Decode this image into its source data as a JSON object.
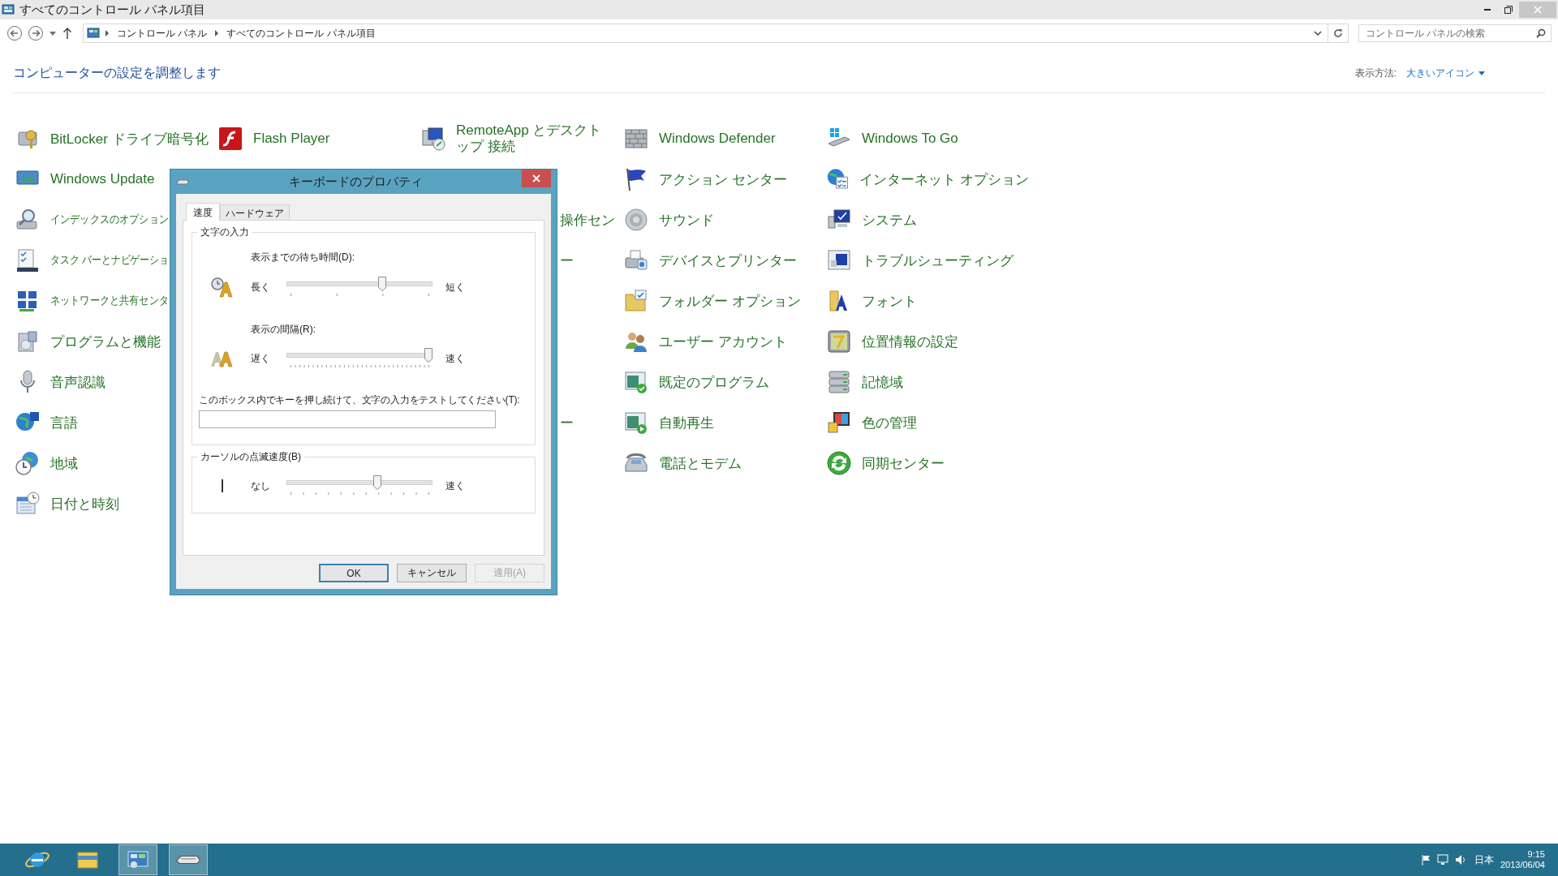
{
  "window": {
    "title": "すべてのコントロール パネル項目"
  },
  "address_bar": {
    "breadcrumbs": [
      "コントロール パネル",
      "すべてのコントロール パネル項目"
    ]
  },
  "search": {
    "placeholder": "コントロール パネルの検索"
  },
  "header": {
    "title": "コンピューターの設定を調整します",
    "view_label": "表示方法:",
    "view_value": "大きいアイコン"
  },
  "columns": [
    [
      {
        "kind": "item",
        "label": "BitLocker ドライブ暗号化"
      },
      {
        "kind": "item",
        "label": "Windows Update"
      },
      {
        "kind": "item",
        "label": "インデックスのオプション"
      },
      {
        "kind": "item",
        "label": "タスク バーとナビゲーショ"
      },
      {
        "kind": "item",
        "label": "ネットワークと共有センタ"
      },
      {
        "kind": "item",
        "label": "プログラムと機能"
      },
      {
        "kind": "item",
        "label": "音声認識"
      },
      {
        "kind": "item",
        "label": "言語"
      },
      {
        "kind": "item",
        "label": "地域"
      },
      {
        "kind": "item",
        "label": "日付と時刻"
      }
    ],
    [
      {
        "kind": "item",
        "label": "Flash Player"
      }
    ],
    [
      {
        "kind": "item",
        "label": "RemoteApp とデスクトップ 接続"
      },
      null,
      {
        "kind": "fragment",
        "label": "操作セン"
      },
      {
        "kind": "fragment",
        "label": "ー"
      },
      null,
      null,
      null,
      {
        "kind": "fragment",
        "label": "ー"
      }
    ],
    [
      {
        "kind": "item",
        "label": "Windows Defender"
      },
      {
        "kind": "item",
        "label": "アクション センター"
      },
      {
        "kind": "item",
        "label": "サウンド"
      },
      {
        "kind": "item",
        "label": "デバイスとプリンター"
      },
      {
        "kind": "item",
        "label": "フォルダー オプション"
      },
      {
        "kind": "item",
        "label": "ユーザー アカウント"
      },
      {
        "kind": "item",
        "label": "既定のプログラム"
      },
      {
        "kind": "item",
        "label": "自動再生"
      },
      {
        "kind": "item",
        "label": "電話とモデム"
      }
    ],
    [
      {
        "kind": "item",
        "label": "Windows To Go"
      },
      {
        "kind": "item",
        "label": "インターネット オプション"
      },
      {
        "kind": "item",
        "label": "システム"
      },
      {
        "kind": "item",
        "label": "トラブルシューティング"
      },
      {
        "kind": "item",
        "label": "フォント"
      },
      {
        "kind": "item",
        "label": "位置情報の設定"
      },
      {
        "kind": "item",
        "label": "記憶域"
      },
      {
        "kind": "item",
        "label": "色の管理"
      },
      {
        "kind": "item",
        "label": "同期センター"
      }
    ]
  ],
  "dialog": {
    "title": "キーボードのプロパティ",
    "tabs": [
      {
        "label": "速度",
        "selected": true
      },
      {
        "label": "ハードウェア",
        "selected": false
      }
    ],
    "groups": [
      {
        "label": "文字の入力",
        "sliders": [
          {
            "kind": "delay",
            "label": "表示までの待ち時間(D):",
            "min_label": "長く",
            "max_label": "短く",
            "level": 0.667
          },
          {
            "kind": "rate",
            "label": "表示の間隔(R):",
            "min_label": "遅く",
            "max_label": "速く",
            "level": 1
          }
        ],
        "test_field": {
          "label": "このボックス内でキーを押し続けて、文字の入力をテストしてください(T):"
        }
      },
      {
        "label": "カーソルの点滅速度(B)",
        "sliders": [
          {
            "kind": "blink",
            "min_label": "なし",
            "max_label": "速く",
            "level": 0.63
          }
        ]
      }
    ],
    "buttons": [
      {
        "label": "OK",
        "default": true,
        "disabled": false
      },
      {
        "label": "キャンセル",
        "default": false,
        "disabled": false
      },
      {
        "label": "適用(A)",
        "default": false,
        "disabled": true
      }
    ]
  },
  "taskbar": {
    "apps": [
      {
        "selected": false
      },
      {
        "selected": false
      },
      {
        "selected": true
      },
      {
        "selected": true
      }
    ],
    "tray": {
      "language": "日本",
      "time": "9:15",
      "date": "2013/06/04"
    }
  }
}
